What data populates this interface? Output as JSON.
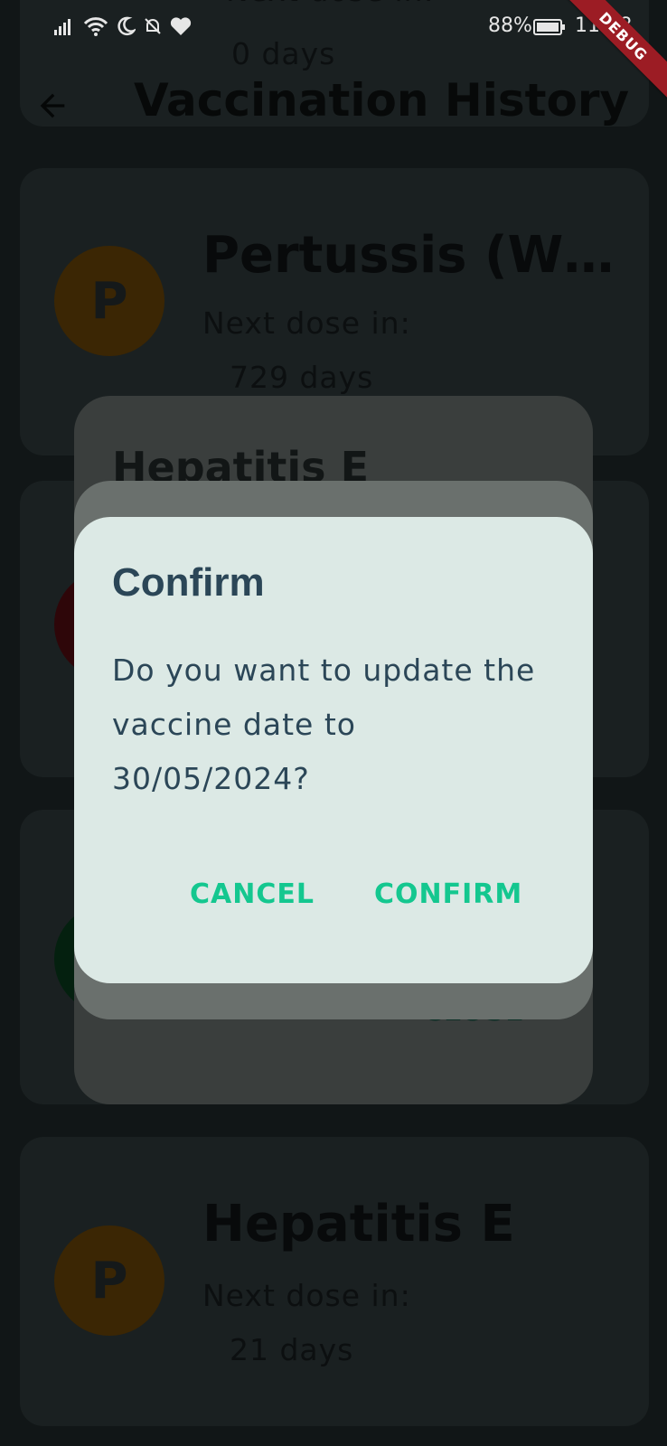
{
  "status_bar": {
    "battery": "88%",
    "time": "11:58"
  },
  "debug_label": "DEBUG",
  "app_bar": {
    "title": "Vaccination History"
  },
  "cards": [
    {
      "title": "",
      "next_label": "Next dose in:",
      "next_value": "0 days",
      "badge": ""
    },
    {
      "title": "Pertussis (Who...",
      "next_label": "Next dose in:",
      "next_value": "729 days",
      "badge": "P"
    },
    {
      "title": "Hepatitis E",
      "next_label": "Next dose in:",
      "next_value": "21 days",
      "badge": "P"
    }
  ],
  "background_dialog": {
    "title": "Hepatitis E",
    "close_label": "CLOSE"
  },
  "confirm_dialog": {
    "title": "Confirm",
    "message": "Do you want to update the vaccine date to 30/05/2024?",
    "cancel_label": "CANCEL",
    "confirm_label": "CONFIRM"
  },
  "colors": {
    "accent": "#14c78f",
    "dialog_text": "#2b4657",
    "dialog_bg": "#dce9e5",
    "badge_orange": "#3b2604",
    "badge_red": "#2e0609",
    "badge_green": "#04200f"
  }
}
